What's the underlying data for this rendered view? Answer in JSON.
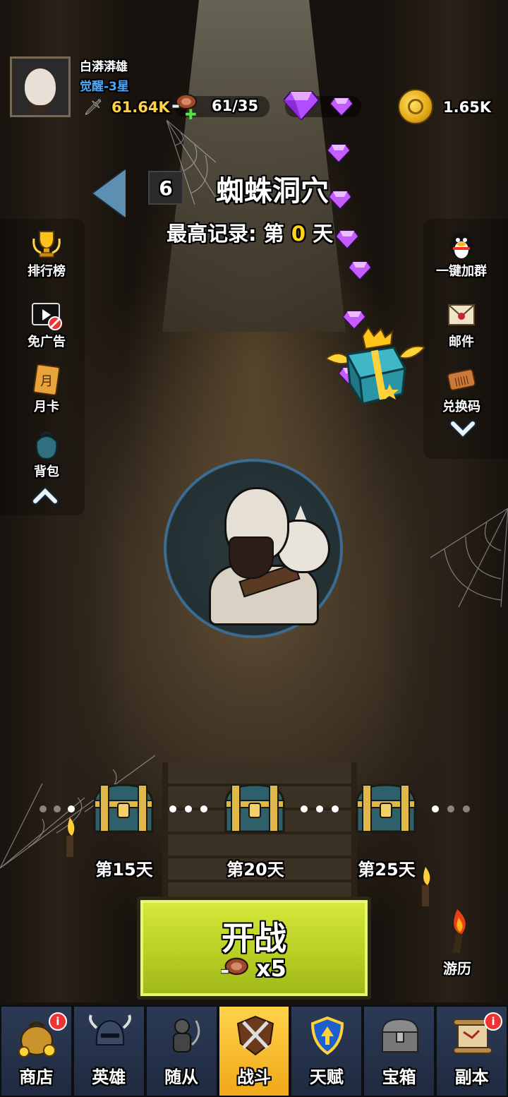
{
  "player": {
    "name": "白漭漭雄",
    "rank": "觉醒-3星",
    "power": "61.64K",
    "energy": "61/35",
    "gold": "1.65K"
  },
  "stage": {
    "number": "6",
    "name": "蜘蛛洞穴",
    "record_prefix": "最高记录: 第",
    "record_day": "0",
    "record_suffix": "天"
  },
  "left_menu": [
    {
      "label": "排行榜",
      "icon": "trophy-icon"
    },
    {
      "label": "免广告",
      "icon": "no-ads-icon"
    },
    {
      "label": "月卡",
      "icon": "month-card-icon"
    },
    {
      "label": "背包",
      "icon": "backpack-icon"
    }
  ],
  "right_menu": [
    {
      "label": "一键加群",
      "icon": "qq-penguin-icon"
    },
    {
      "label": "邮件",
      "icon": "mail-icon"
    },
    {
      "label": "兑换码",
      "icon": "redeem-ticket-icon"
    }
  ],
  "milestones": [
    {
      "label": "第15天"
    },
    {
      "label": "第20天"
    },
    {
      "label": "第25天"
    }
  ],
  "battle": {
    "label": "开战",
    "cost": "x5"
  },
  "travel": {
    "label": "游历"
  },
  "nav": [
    {
      "label": "商店",
      "icon": "shop-money-bag-icon",
      "badge": "i"
    },
    {
      "label": "英雄",
      "icon": "hero-helmet-icon",
      "badge": ""
    },
    {
      "label": "随从",
      "icon": "follower-knight-icon",
      "badge": ""
    },
    {
      "label": "战斗",
      "icon": "battle-swords-icon",
      "badge": "",
      "active": true
    },
    {
      "label": "天赋",
      "icon": "talent-shield-icon",
      "badge": ""
    },
    {
      "label": "宝箱",
      "icon": "treasure-chest-icon",
      "badge": ""
    },
    {
      "label": "副本",
      "icon": "dungeon-scroll-icon",
      "badge": "i"
    }
  ],
  "colors": {
    "accent_yellow": "#ffd41a",
    "rank_blue": "#4aa8ff",
    "battle_green": "#c4dc2c",
    "nav_active": "#f4b41f"
  }
}
